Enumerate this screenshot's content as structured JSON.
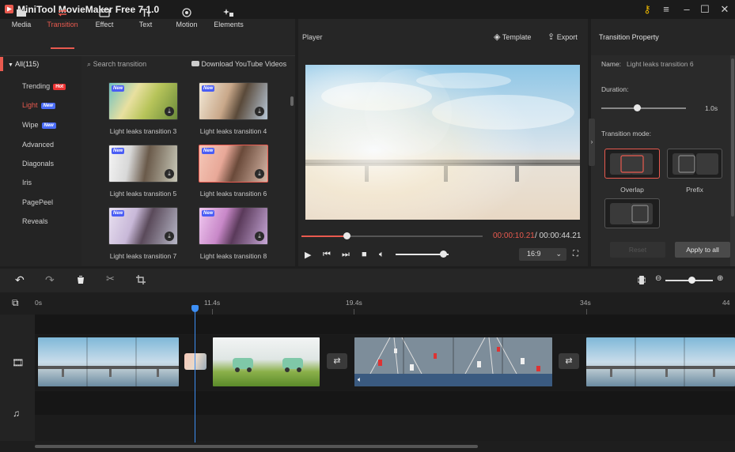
{
  "app": {
    "title": "MiniTool MovieMaker Free 7.1.0"
  },
  "toolbar": {
    "tabs": [
      {
        "label": "Media",
        "icon": "folder-icon"
      },
      {
        "label": "Transition",
        "icon": "transition-icon",
        "active": true
      },
      {
        "label": "Effect",
        "icon": "effect-icon"
      },
      {
        "label": "Text",
        "icon": "text-icon"
      },
      {
        "label": "Motion",
        "icon": "motion-icon"
      },
      {
        "label": "Elements",
        "icon": "elements-icon"
      }
    ]
  },
  "categories": {
    "all": "All(115)",
    "items": [
      {
        "label": "Trending",
        "badge": "Hot"
      },
      {
        "label": "Light",
        "badge": "New",
        "selected": true
      },
      {
        "label": "Wipe",
        "badge": "New"
      },
      {
        "label": "Advanced"
      },
      {
        "label": "Diagonals"
      },
      {
        "label": "Iris"
      },
      {
        "label": "PagePeel"
      },
      {
        "label": "Reveals"
      }
    ]
  },
  "search": {
    "placeholder": "Search transition",
    "download_label": "Download YouTube Videos"
  },
  "transitions": [
    {
      "label": "Light leaks transition 3",
      "tag": "New"
    },
    {
      "label": "Light leaks transition 4",
      "tag": "New"
    },
    {
      "label": "Light leaks transition 5",
      "tag": "New"
    },
    {
      "label": "Light leaks transition 6",
      "tag": "New",
      "selected": true
    },
    {
      "label": "Light leaks transition 7",
      "tag": "New"
    },
    {
      "label": "Light leaks transition 8",
      "tag": "New"
    }
  ],
  "player": {
    "label": "Player",
    "template_label": "Template",
    "export_label": "Export",
    "time_current": "00:00:10.21",
    "time_total": "/ 00:00:44.21",
    "progress": 0.25,
    "volume": 0.9,
    "aspect": "16:9"
  },
  "property": {
    "title": "Transition Property",
    "name_label": "Name:",
    "name_value": "Light leaks transition 6",
    "duration_label": "Duration:",
    "duration_value": "1.0s",
    "mode_label": "Transition mode:",
    "modes": [
      "Overlap",
      "Prefix"
    ],
    "reset_label": "Reset",
    "apply_label": "Apply to all"
  },
  "timeline": {
    "ticks": [
      "0s",
      "11.4s",
      "19.4s",
      "34s",
      "44"
    ],
    "zoom_level": 0.55
  },
  "colors": {
    "accent": "#e95a4f",
    "playhead": "#3d8ff5",
    "badge_new": "#4a5df5",
    "badge_hot": "#ee3333"
  }
}
